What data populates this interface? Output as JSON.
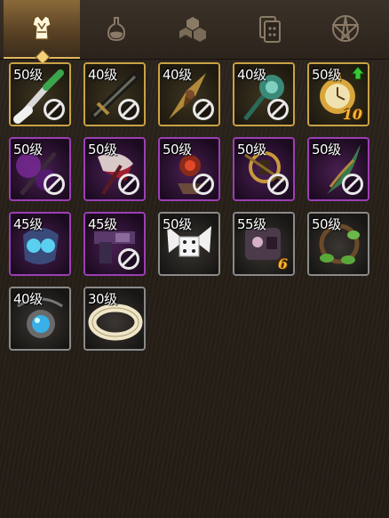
{
  "tabs": [
    {
      "name": "armor-tab",
      "icon": "armor-icon",
      "active": true
    },
    {
      "name": "potion-tab",
      "icon": "potion-icon",
      "active": false
    },
    {
      "name": "materials-tab",
      "icon": "cubes-icon",
      "active": false
    },
    {
      "name": "cards-tab",
      "icon": "cards-icon",
      "active": false
    },
    {
      "name": "star-tab",
      "icon": "pentagram-icon",
      "active": false
    }
  ],
  "items": [
    {
      "level": "50级",
      "rarity": "gold",
      "icon": "green-brush-weapon",
      "locked": true
    },
    {
      "level": "40级",
      "rarity": "gold",
      "icon": "dark-sword",
      "locked": true
    },
    {
      "level": "40级",
      "rarity": "gold",
      "icon": "golden-blade",
      "locked": true
    },
    {
      "level": "40级",
      "rarity": "gold",
      "icon": "teal-flower-staff",
      "locked": true
    },
    {
      "level": "50级",
      "rarity": "gold",
      "icon": "golden-pocket-watch",
      "locked": false,
      "count": "10",
      "upgrade": true
    },
    {
      "level": "50级",
      "rarity": "purple",
      "icon": "purple-cloud-staff",
      "locked": true
    },
    {
      "level": "50级",
      "rarity": "purple",
      "icon": "red-white-axe",
      "locked": true
    },
    {
      "level": "50级",
      "rarity": "purple",
      "icon": "red-gem-amulet",
      "locked": true
    },
    {
      "level": "50级",
      "rarity": "purple",
      "icon": "golden-key-ring",
      "locked": true
    },
    {
      "level": "50级",
      "rarity": "purple",
      "icon": "green-wing-blade",
      "locked": true
    },
    {
      "level": "45级",
      "rarity": "purple",
      "icon": "blue-crystal-gauntlet",
      "locked": false
    },
    {
      "level": "45级",
      "rarity": "purple",
      "icon": "purple-revolver",
      "locked": true
    },
    {
      "level": "50级",
      "rarity": "gray",
      "icon": "white-dice-ribbon",
      "locked": false
    },
    {
      "level": "55级",
      "rarity": "gray",
      "icon": "purple-robot-head",
      "locked": false,
      "count": "6"
    },
    {
      "level": "50级",
      "rarity": "gray",
      "icon": "leaf-vine-wreath",
      "locked": false
    },
    {
      "level": "40级",
      "rarity": "gray",
      "icon": "blue-orb-pendant",
      "locked": false
    },
    {
      "level": "30级",
      "rarity": "gray",
      "icon": "ivory-bracelet",
      "locked": false
    }
  ]
}
